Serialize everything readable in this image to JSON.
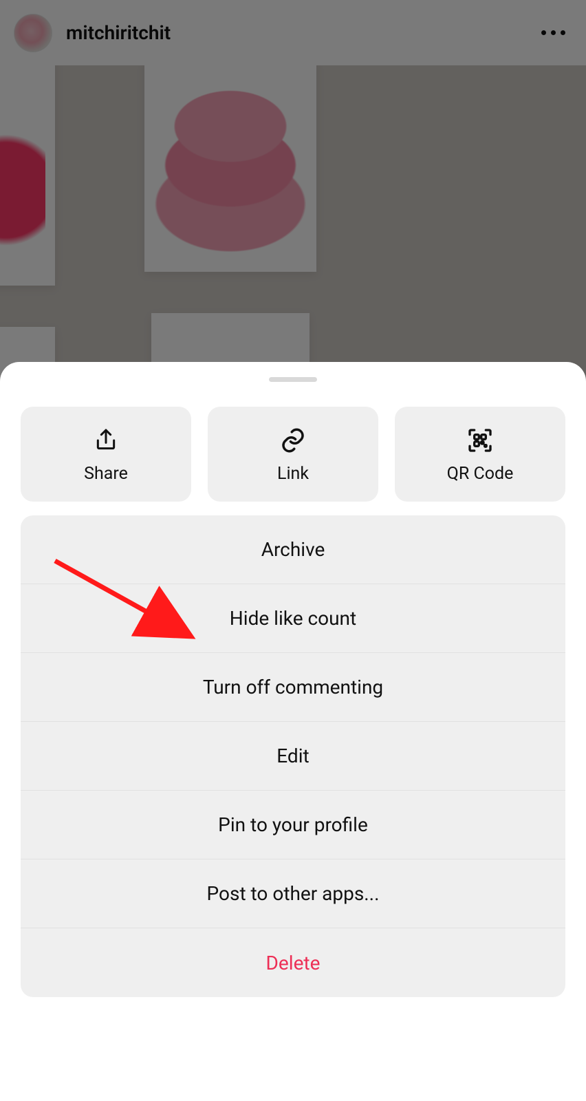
{
  "header": {
    "username": "mitchiritchit"
  },
  "sheet": {
    "top_actions": {
      "share": "Share",
      "link": "Link",
      "qr": "QR Code"
    },
    "menu": {
      "archive": "Archive",
      "hide_likes": "Hide like count",
      "turn_off_commenting": "Turn off commenting",
      "edit": "Edit",
      "pin": "Pin to your profile",
      "post_other": "Post to other apps...",
      "delete": "Delete"
    }
  },
  "annotation": {
    "arrow_target": "hide-like-count"
  }
}
